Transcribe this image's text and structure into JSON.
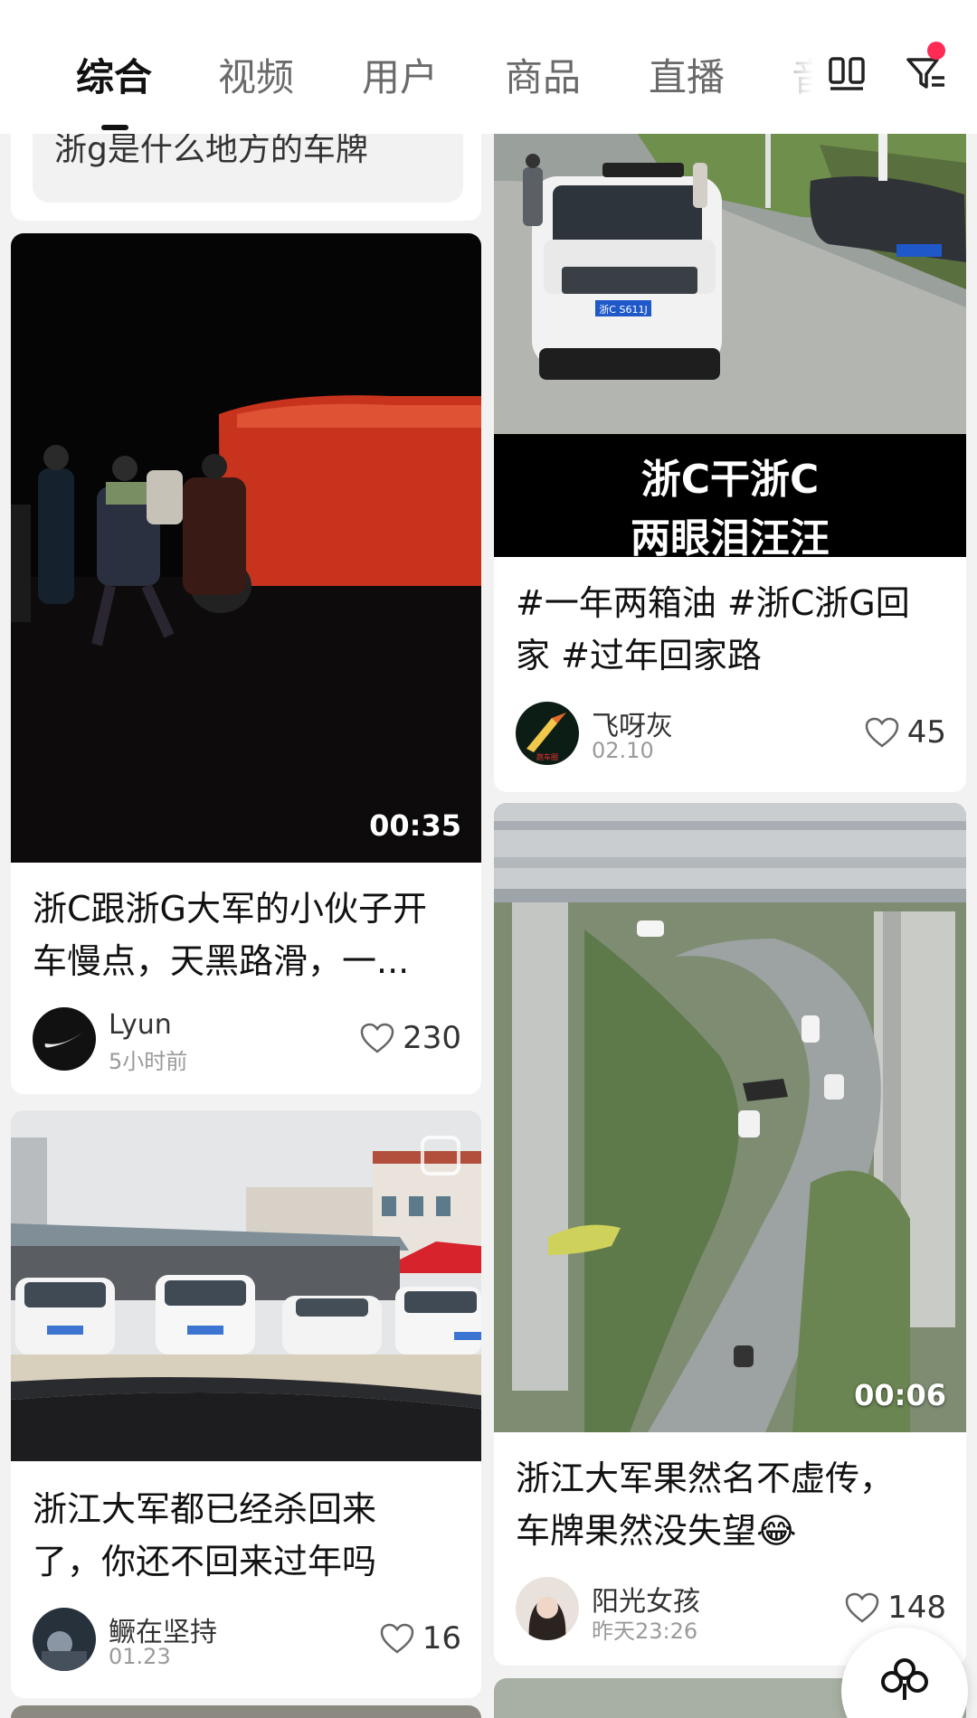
{
  "tabs": [
    {
      "label": "综合",
      "active": true
    },
    {
      "label": "视频",
      "active": false
    },
    {
      "label": "用户",
      "active": false
    },
    {
      "label": "商品",
      "active": false
    },
    {
      "label": "直播",
      "active": false
    },
    {
      "label": "音",
      "active": false
    }
  ],
  "header_icons": [
    "grid-view-icon",
    "filter-icon"
  ],
  "accent_color": "#ff2b55",
  "partial_query": "浙g是什么地方的车牌",
  "cards": {
    "left_1": {
      "duration": "00:35",
      "title_line1": "浙C跟浙G大军的小伙子开",
      "title_line2": "车慢点，天黑路滑，一...",
      "author": "Lyun",
      "time": "5小时前",
      "likes": "230"
    },
    "left_2": {
      "title_line1": "浙江大军都已经杀回来",
      "title_line2": "了，你还不回来过年吗",
      "author": "鳜在坚持",
      "time": "01.23",
      "likes": "16"
    },
    "right_1": {
      "overlay_line1": "浙C干浙C",
      "overlay_line2": "两眼泪汪汪",
      "plate": "浙C S611J",
      "title_line1": "#一年两箱油 #浙C浙G回",
      "title_line2": "家 #过年回家路",
      "author": "飞呀灰",
      "avatar_text": "跑车圈",
      "time": "02.10",
      "likes": "45"
    },
    "right_2": {
      "duration": "00:06",
      "title_line1": "浙江大军果然名不虚传，",
      "title_line2": "车牌果然没失望😂",
      "author": "阳光女孩",
      "time": "昨天23:26",
      "likes": "148"
    }
  }
}
